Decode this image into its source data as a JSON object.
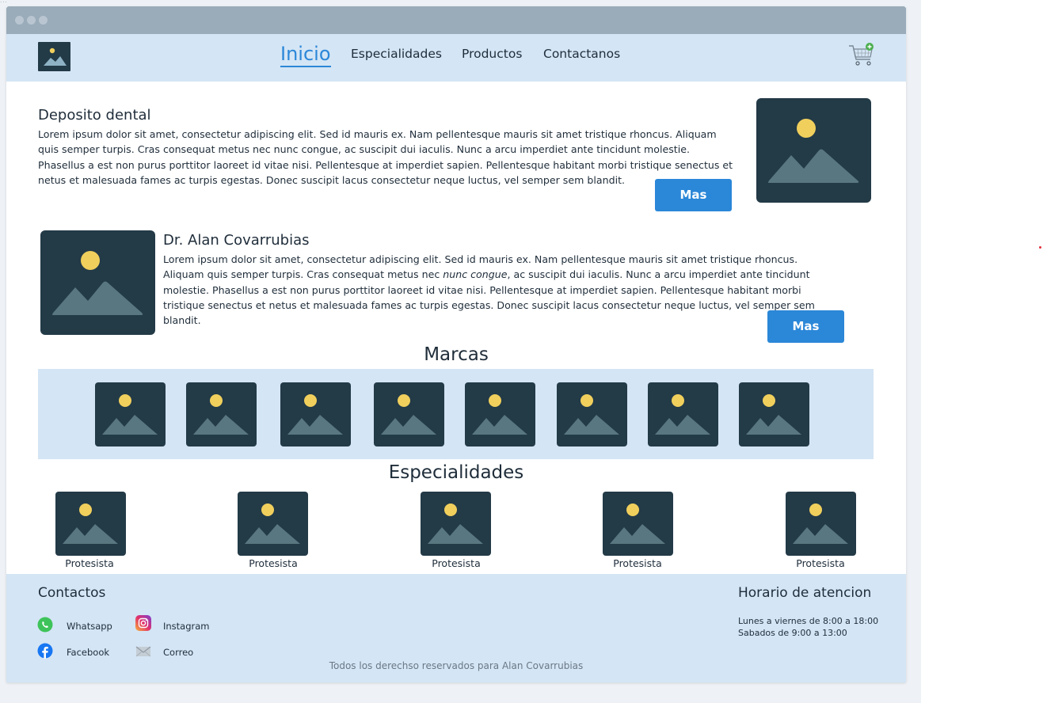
{
  "nav": {
    "items": [
      "Inicio",
      "Especialidades",
      "Productos",
      "Contactanos"
    ],
    "active": "Inicio"
  },
  "sections": {
    "deposito": {
      "title": "Deposito dental",
      "text": "Lorem ipsum dolor sit amet, consectetur adipiscing elit. Sed id mauris ex. Nam pellentesque mauris sit amet tristique rhoncus. Aliquam quis semper turpis. Cras consequat metus nec nunc congue, ac suscipit dui iaculis. Nunc a arcu imperdiet ante tincidunt molestie. Phasellus a est non purus porttitor laoreet id vitae nisi. Pellentesque at imperdiet sapien. Pellentesque habitant morbi tristique senectus et netus et malesuada fames ac turpis egestas. Donec suscipit lacus consectetur neque luctus, vel semper sem blandit.",
      "button": "Mas"
    },
    "doctor": {
      "title": "Dr. Alan Covarrubias",
      "text_before": "Lorem ipsum dolor sit amet, consectetur adipiscing elit. Sed id mauris ex. Nam pellentesque mauris sit amet tristique rhoncus. Aliquam quis semper turpis. Cras consequat metus nec ",
      "text_italic": "nunc congue",
      "text_after": ", ac suscipit dui iaculis. Nunc a arcu imperdiet ante tincidunt molestie. Phasellus a est non purus porttitor laoreet id vitae nisi. Pellentesque at imperdiet sapien. Pellentesque habitant morbi tristique senectus et netus et malesuada fames ac turpis egestas. Donec suscipit lacus consectetur neque luctus, vel semper sem blandit.",
      "button": "Mas"
    }
  },
  "marcas": {
    "title": "Marcas",
    "count": 8
  },
  "especialidades": {
    "title": "Especialidades",
    "items": [
      "Protesista",
      "Protesista",
      "Protesista",
      "Protesista",
      "Protesista"
    ]
  },
  "footer": {
    "contact_title": "Contactos",
    "links": {
      "whatsapp": "Whatsapp",
      "instagram": "Instagram",
      "facebook": "Facebook",
      "correo": "Correo"
    },
    "hours_title": "Horario de atencion",
    "hours_line1": "Lunes a viernes de 8:00 a 18:00",
    "hours_line2": "Sabados de 9:00 a 13:00",
    "copyright": "Todos los derechso reservados para Alan Covarrubias"
  },
  "icons": [
    "image-placeholder-icon",
    "cart-icon",
    "whatsapp-icon",
    "instagram-icon",
    "facebook-icon",
    "mail-icon"
  ],
  "colors": {
    "accent": "#2b87d8",
    "nav_bg": "#d4e5f5",
    "placeholder_bg": "#233a47",
    "sun": "#f0cf5c",
    "mountain": "#597780"
  }
}
